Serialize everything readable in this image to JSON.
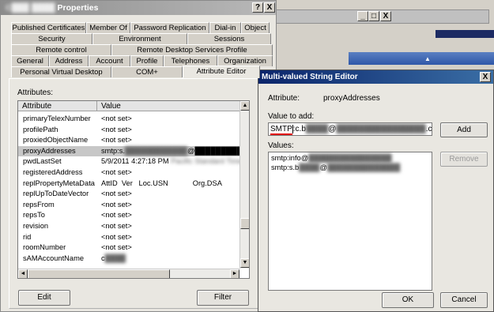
{
  "properties_window": {
    "title_blurred": "C███ ████",
    "title": "Properties",
    "help_btn": "?",
    "close_btn": "X",
    "tabs_row1": [
      "Published Certificates",
      "Member Of",
      "Password Replication",
      "Dial-in",
      "Object"
    ],
    "tabs_row2": [
      "Security",
      "Environment",
      "Sessions"
    ],
    "tabs_row3": [
      "Remote control",
      "Remote Desktop Services Profile"
    ],
    "tabs_row4": [
      "General",
      "Address",
      "Account",
      "Profile",
      "Telephones",
      "Organization"
    ],
    "tabs_row5": [
      "Personal Virtual Desktop",
      "COM+",
      "Attribute Editor"
    ],
    "attributes_label": "Attributes:",
    "col_attribute": "Attribute",
    "col_value": "Value",
    "rows": [
      {
        "attr": "primaryTelexNumber",
        "val": "<not set>"
      },
      {
        "attr": "profilePath",
        "val": "<not set>"
      },
      {
        "attr": "proxiedObjectName",
        "val": "<not set>"
      },
      {
        "attr": "proxyAddresses",
        "val": "smtp:s.",
        "val_blur": "████████████",
        "val_tail": "@██████████ com; smtp:info"
      },
      {
        "attr": "pwdLastSet",
        "val": "5/9/2011 4:27:18 PM",
        "val_blur": "Pacific Standard Time"
      },
      {
        "attr": "registeredAddress",
        "val": "<not set>"
      },
      {
        "attr": "replPropertyMetaData",
        "val": "AttID  Ver   Loc.USN            Org.DSA"
      },
      {
        "attr": "replUpToDateVector",
        "val": "<not set>"
      },
      {
        "attr": "repsFrom",
        "val": "<not set>"
      },
      {
        "attr": "repsTo",
        "val": "<not set>"
      },
      {
        "attr": "revision",
        "val": "<not set>"
      },
      {
        "attr": "rid",
        "val": "<not set>"
      },
      {
        "attr": "roomNumber",
        "val": "<not set>"
      },
      {
        "attr": "sAMAccountName",
        "val": "c",
        "val_blur": "████"
      }
    ],
    "edit_btn": "Edit",
    "filter_btn": "Filter"
  },
  "background_window": {
    "min": "_",
    "max": "□",
    "close": "X"
  },
  "editor": {
    "title": "Multi-valued String Editor",
    "close_btn": "X",
    "attribute_label": "Attribute:",
    "attribute_value": "proxyAddresses",
    "value_to_add_label": "Value to add:",
    "input_prefix": "SMTP",
    "input_mid": ":c.b",
    "input_blur1": "████",
    "input_at": "@",
    "input_blur2": "████████████████",
    "input_suffix": ".com",
    "add_btn": "Add",
    "values_label": "Values:",
    "values": [
      {
        "pre": "smtp:info@",
        "blur": "████████████████"
      },
      {
        "pre": "smtp:s.b",
        "blur": "████",
        "at": "@",
        "blur2": "██████████████"
      }
    ],
    "remove_btn": "Remove",
    "ok_btn": "OK",
    "cancel_btn": "Cancel"
  }
}
